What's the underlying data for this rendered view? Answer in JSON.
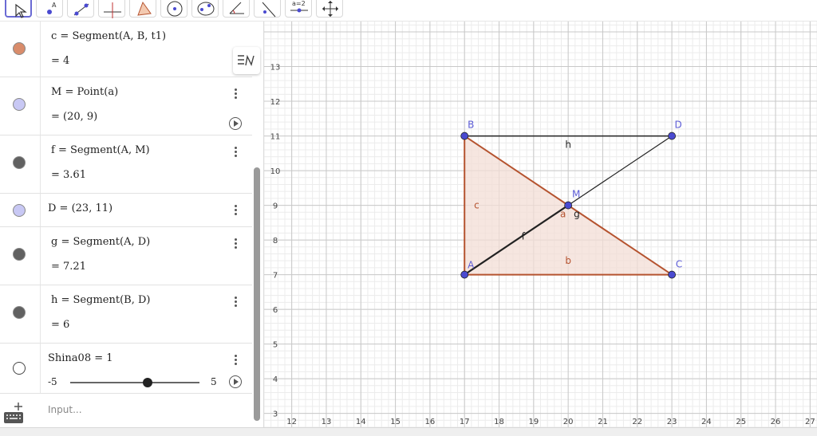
{
  "toolbar": {
    "tools": [
      "move-tool",
      "point-tool",
      "line-tool",
      "perpendicular-tool",
      "polygon-tool",
      "circle-tool",
      "ellipse-tool",
      "angle-tool",
      "reflect-tool",
      "slider-tool",
      "move-view-tool"
    ],
    "slider_tool_label": "a=2"
  },
  "algebra": {
    "rows": [
      {
        "expr": "c = Segment(A, B, t1)",
        "value": "= 4",
        "color": "#d98c6b"
      },
      {
        "expr": "M = Point(a)",
        "value": "= (20, 9)",
        "color": "#c8c8f4"
      },
      {
        "expr": "f = Segment(A, M)",
        "value": "= 3.61",
        "color": "#616161"
      },
      {
        "expr": "D = (23, 11)",
        "value": "",
        "color": "#c8c8f4"
      },
      {
        "expr": "g = Segment(A, D)",
        "value": "= 7.21",
        "color": "#616161"
      },
      {
        "expr": "h = Segment(B, D)",
        "value": "= 6",
        "color": "#616161"
      },
      {
        "expr": "Shina08 = 1",
        "value": "",
        "color": "#ffffff"
      }
    ],
    "slider": {
      "min": "-5",
      "max": "5",
      "value": 1
    },
    "input_placeholder": "Input..."
  },
  "graph": {
    "x_range": [
      11.2,
      27.2
    ],
    "y_range": [
      2.6,
      14.3
    ],
    "x_ticks": [
      12,
      13,
      14,
      15,
      16,
      17,
      18,
      19,
      20,
      21,
      22,
      23,
      24,
      25,
      26,
      27
    ],
    "y_ticks": [
      3,
      4,
      5,
      6,
      7,
      8,
      9,
      10,
      11,
      12,
      13
    ],
    "points": [
      {
        "name": "A",
        "x": 17,
        "y": 7
      },
      {
        "name": "B",
        "x": 17,
        "y": 11
      },
      {
        "name": "C",
        "x": 23,
        "y": 7
      },
      {
        "name": "D",
        "x": 23,
        "y": 11
      },
      {
        "name": "M",
        "x": 20,
        "y": 9
      }
    ],
    "segment_labels": [
      {
        "name": "c",
        "x": 17.35,
        "y": 9.0
      },
      {
        "name": "b",
        "x": 20.0,
        "y": 7.4
      },
      {
        "name": "h",
        "x": 20.0,
        "y": 10.75
      },
      {
        "name": "f",
        "x": 18.7,
        "y": 8.1
      },
      {
        "name": "a",
        "x": 19.85,
        "y": 8.75
      },
      {
        "name": "g",
        "x": 20.25,
        "y": 8.75
      }
    ],
    "colors": {
      "triangle": "#b5532f",
      "triangle_fill": "#f3ddd6",
      "line": "#222222",
      "point": "#4a4ad0",
      "label_point": "#5c5cd6",
      "label_segment": "#b5532f"
    }
  }
}
